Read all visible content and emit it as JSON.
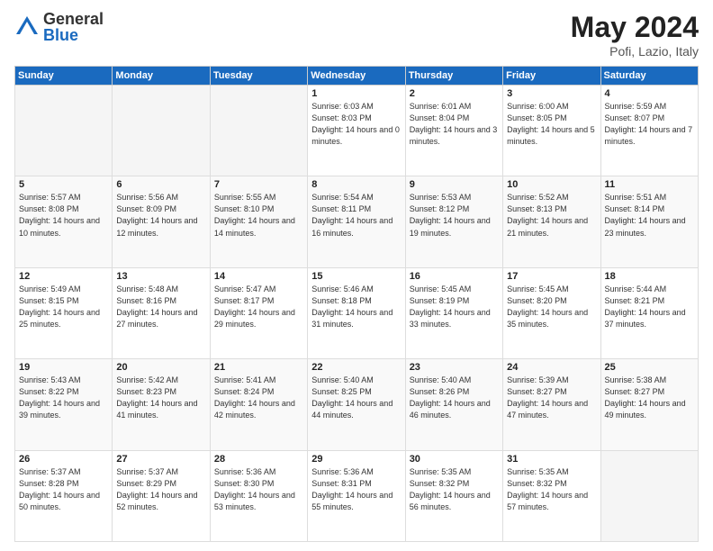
{
  "logo": {
    "general": "General",
    "blue": "Blue"
  },
  "title": {
    "month_year": "May 2024",
    "location": "Pofi, Lazio, Italy"
  },
  "header_days": [
    "Sunday",
    "Monday",
    "Tuesday",
    "Wednesday",
    "Thursday",
    "Friday",
    "Saturday"
  ],
  "weeks": [
    [
      {
        "day": "",
        "sunrise": "",
        "sunset": "",
        "daylight": ""
      },
      {
        "day": "",
        "sunrise": "",
        "sunset": "",
        "daylight": ""
      },
      {
        "day": "",
        "sunrise": "",
        "sunset": "",
        "daylight": ""
      },
      {
        "day": "1",
        "sunrise": "Sunrise: 6:03 AM",
        "sunset": "Sunset: 8:03 PM",
        "daylight": "Daylight: 14 hours and 0 minutes."
      },
      {
        "day": "2",
        "sunrise": "Sunrise: 6:01 AM",
        "sunset": "Sunset: 8:04 PM",
        "daylight": "Daylight: 14 hours and 3 minutes."
      },
      {
        "day": "3",
        "sunrise": "Sunrise: 6:00 AM",
        "sunset": "Sunset: 8:05 PM",
        "daylight": "Daylight: 14 hours and 5 minutes."
      },
      {
        "day": "4",
        "sunrise": "Sunrise: 5:59 AM",
        "sunset": "Sunset: 8:07 PM",
        "daylight": "Daylight: 14 hours and 7 minutes."
      }
    ],
    [
      {
        "day": "5",
        "sunrise": "Sunrise: 5:57 AM",
        "sunset": "Sunset: 8:08 PM",
        "daylight": "Daylight: 14 hours and 10 minutes."
      },
      {
        "day": "6",
        "sunrise": "Sunrise: 5:56 AM",
        "sunset": "Sunset: 8:09 PM",
        "daylight": "Daylight: 14 hours and 12 minutes."
      },
      {
        "day": "7",
        "sunrise": "Sunrise: 5:55 AM",
        "sunset": "Sunset: 8:10 PM",
        "daylight": "Daylight: 14 hours and 14 minutes."
      },
      {
        "day": "8",
        "sunrise": "Sunrise: 5:54 AM",
        "sunset": "Sunset: 8:11 PM",
        "daylight": "Daylight: 14 hours and 16 minutes."
      },
      {
        "day": "9",
        "sunrise": "Sunrise: 5:53 AM",
        "sunset": "Sunset: 8:12 PM",
        "daylight": "Daylight: 14 hours and 19 minutes."
      },
      {
        "day": "10",
        "sunrise": "Sunrise: 5:52 AM",
        "sunset": "Sunset: 8:13 PM",
        "daylight": "Daylight: 14 hours and 21 minutes."
      },
      {
        "day": "11",
        "sunrise": "Sunrise: 5:51 AM",
        "sunset": "Sunset: 8:14 PM",
        "daylight": "Daylight: 14 hours and 23 minutes."
      }
    ],
    [
      {
        "day": "12",
        "sunrise": "Sunrise: 5:49 AM",
        "sunset": "Sunset: 8:15 PM",
        "daylight": "Daylight: 14 hours and 25 minutes."
      },
      {
        "day": "13",
        "sunrise": "Sunrise: 5:48 AM",
        "sunset": "Sunset: 8:16 PM",
        "daylight": "Daylight: 14 hours and 27 minutes."
      },
      {
        "day": "14",
        "sunrise": "Sunrise: 5:47 AM",
        "sunset": "Sunset: 8:17 PM",
        "daylight": "Daylight: 14 hours and 29 minutes."
      },
      {
        "day": "15",
        "sunrise": "Sunrise: 5:46 AM",
        "sunset": "Sunset: 8:18 PM",
        "daylight": "Daylight: 14 hours and 31 minutes."
      },
      {
        "day": "16",
        "sunrise": "Sunrise: 5:45 AM",
        "sunset": "Sunset: 8:19 PM",
        "daylight": "Daylight: 14 hours and 33 minutes."
      },
      {
        "day": "17",
        "sunrise": "Sunrise: 5:45 AM",
        "sunset": "Sunset: 8:20 PM",
        "daylight": "Daylight: 14 hours and 35 minutes."
      },
      {
        "day": "18",
        "sunrise": "Sunrise: 5:44 AM",
        "sunset": "Sunset: 8:21 PM",
        "daylight": "Daylight: 14 hours and 37 minutes."
      }
    ],
    [
      {
        "day": "19",
        "sunrise": "Sunrise: 5:43 AM",
        "sunset": "Sunset: 8:22 PM",
        "daylight": "Daylight: 14 hours and 39 minutes."
      },
      {
        "day": "20",
        "sunrise": "Sunrise: 5:42 AM",
        "sunset": "Sunset: 8:23 PM",
        "daylight": "Daylight: 14 hours and 41 minutes."
      },
      {
        "day": "21",
        "sunrise": "Sunrise: 5:41 AM",
        "sunset": "Sunset: 8:24 PM",
        "daylight": "Daylight: 14 hours and 42 minutes."
      },
      {
        "day": "22",
        "sunrise": "Sunrise: 5:40 AM",
        "sunset": "Sunset: 8:25 PM",
        "daylight": "Daylight: 14 hours and 44 minutes."
      },
      {
        "day": "23",
        "sunrise": "Sunrise: 5:40 AM",
        "sunset": "Sunset: 8:26 PM",
        "daylight": "Daylight: 14 hours and 46 minutes."
      },
      {
        "day": "24",
        "sunrise": "Sunrise: 5:39 AM",
        "sunset": "Sunset: 8:27 PM",
        "daylight": "Daylight: 14 hours and 47 minutes."
      },
      {
        "day": "25",
        "sunrise": "Sunrise: 5:38 AM",
        "sunset": "Sunset: 8:27 PM",
        "daylight": "Daylight: 14 hours and 49 minutes."
      }
    ],
    [
      {
        "day": "26",
        "sunrise": "Sunrise: 5:37 AM",
        "sunset": "Sunset: 8:28 PM",
        "daylight": "Daylight: 14 hours and 50 minutes."
      },
      {
        "day": "27",
        "sunrise": "Sunrise: 5:37 AM",
        "sunset": "Sunset: 8:29 PM",
        "daylight": "Daylight: 14 hours and 52 minutes."
      },
      {
        "day": "28",
        "sunrise": "Sunrise: 5:36 AM",
        "sunset": "Sunset: 8:30 PM",
        "daylight": "Daylight: 14 hours and 53 minutes."
      },
      {
        "day": "29",
        "sunrise": "Sunrise: 5:36 AM",
        "sunset": "Sunset: 8:31 PM",
        "daylight": "Daylight: 14 hours and 55 minutes."
      },
      {
        "day": "30",
        "sunrise": "Sunrise: 5:35 AM",
        "sunset": "Sunset: 8:32 PM",
        "daylight": "Daylight: 14 hours and 56 minutes."
      },
      {
        "day": "31",
        "sunrise": "Sunrise: 5:35 AM",
        "sunset": "Sunset: 8:32 PM",
        "daylight": "Daylight: 14 hours and 57 minutes."
      },
      {
        "day": "",
        "sunrise": "",
        "sunset": "",
        "daylight": ""
      }
    ]
  ]
}
